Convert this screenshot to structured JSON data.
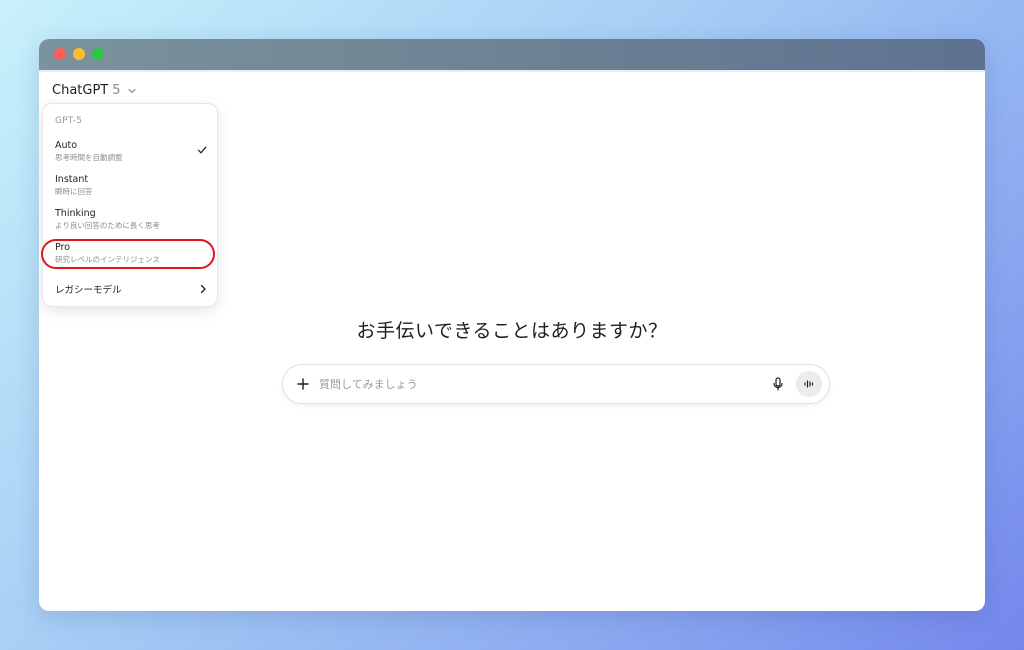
{
  "window": {
    "controls": [
      "close",
      "minimize",
      "maximize"
    ]
  },
  "header": {
    "model_name": "ChatGPT",
    "model_version": "5"
  },
  "model_menu": {
    "section_label": "GPT-5",
    "items": [
      {
        "title": "Auto",
        "description": "思考時間を自動調整",
        "selected": true
      },
      {
        "title": "Instant",
        "description": "瞬時に回答",
        "selected": false
      },
      {
        "title": "Thinking",
        "description": "より良い回答のために長く思考",
        "selected": false
      },
      {
        "title": "Pro",
        "description": "研究レベルのインテリジェンス",
        "selected": false,
        "highlighted": true
      }
    ],
    "legacy_label": "レガシーモデル"
  },
  "main": {
    "headline": "お手伝いできることはありますか？"
  },
  "composer": {
    "placeholder": "質問してみましょう",
    "value": ""
  },
  "colors": {
    "highlight_ring": "#e3141c",
    "voice_button_bg": "#ececec"
  },
  "icons": [
    "chevron-down-icon",
    "check-icon",
    "chevron-right-icon",
    "plus-icon",
    "microphone-icon",
    "voice-waveform-icon"
  ]
}
